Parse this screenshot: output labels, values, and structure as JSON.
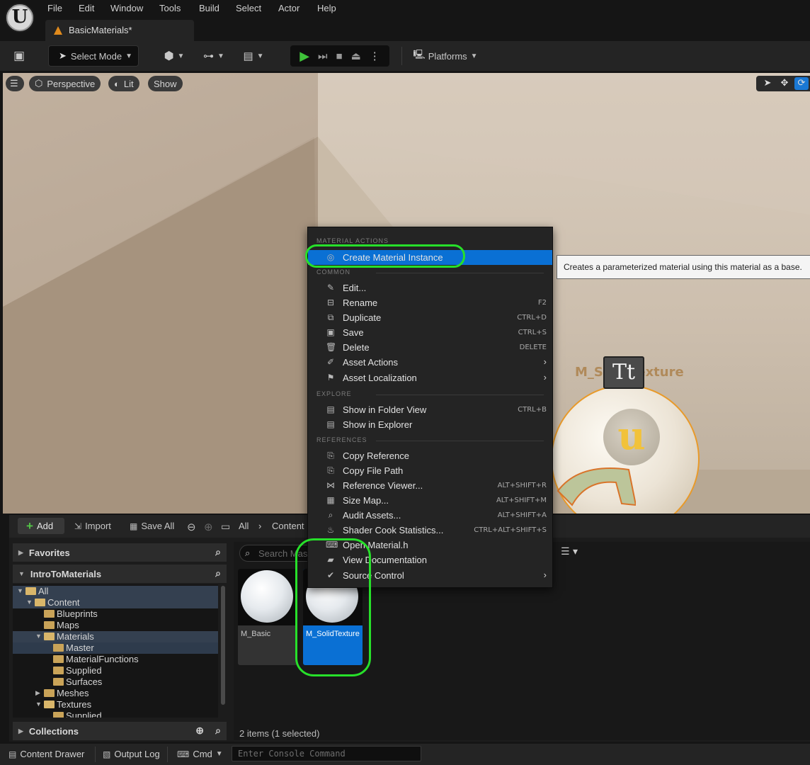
{
  "menubar": {
    "items": [
      "File",
      "Edit",
      "Window",
      "Tools",
      "Build",
      "Select",
      "Actor",
      "Help"
    ],
    "tab_label": "BasicMaterials*"
  },
  "toolbar": {
    "select_mode": "Select Mode",
    "platforms": "Platforms"
  },
  "viewport": {
    "menu_btn": "☰",
    "perspective": "Perspective",
    "lit": "Lit",
    "show": "Show",
    "sphere_label": "M_SolidTexture",
    "badge_text": "Tt"
  },
  "context_menu": {
    "sections": {
      "material_actions": "MATERIAL ACTIONS",
      "common": "COMMON",
      "explore": "EXPLORE",
      "references": "REFERENCES"
    },
    "items": [
      {
        "label": "Create Material Instance",
        "shortcut": "",
        "icon": "material-instance-icon",
        "glyph": "◎"
      },
      {
        "label": "Edit...",
        "shortcut": "",
        "icon": "pencil-icon",
        "glyph": "✎"
      },
      {
        "label": "Rename",
        "shortcut": "F2",
        "icon": "rename-icon",
        "glyph": "⊟"
      },
      {
        "label": "Duplicate",
        "shortcut": "CTRL+D",
        "icon": "duplicate-icon",
        "glyph": "⧉"
      },
      {
        "label": "Save",
        "shortcut": "CTRL+S",
        "icon": "save-icon",
        "glyph": "▣"
      },
      {
        "label": "Delete",
        "shortcut": "DELETE",
        "icon": "trash-icon",
        "glyph": "🗑"
      },
      {
        "label": "Asset Actions",
        "shortcut": "",
        "icon": "wrench-icon",
        "glyph": "✐",
        "submenu": true
      },
      {
        "label": "Asset Localization",
        "shortcut": "",
        "icon": "flag-icon",
        "glyph": "⚑",
        "submenu": true
      },
      {
        "label": "Show in Folder View",
        "shortcut": "CTRL+B",
        "icon": "folder-search-icon",
        "glyph": "▤"
      },
      {
        "label": "Show in Explorer",
        "shortcut": "",
        "icon": "explorer-icon",
        "glyph": "▤"
      },
      {
        "label": "Copy Reference",
        "shortcut": "",
        "icon": "copy-reference-icon",
        "glyph": "⎘"
      },
      {
        "label": "Copy File Path",
        "shortcut": "",
        "icon": "copy-path-icon",
        "glyph": "⎘"
      },
      {
        "label": "Reference Viewer...",
        "shortcut": "ALT+SHIFT+R",
        "icon": "reference-viewer-icon",
        "glyph": "⋈"
      },
      {
        "label": "Size Map...",
        "shortcut": "ALT+SHIFT+M",
        "icon": "size-map-icon",
        "glyph": "▦"
      },
      {
        "label": "Audit Assets...",
        "shortcut": "ALT+SHIFT+A",
        "icon": "audit-icon",
        "glyph": "⌕"
      },
      {
        "label": "Shader Cook Statistics...",
        "shortcut": "CTRL+ALT+SHIFT+S",
        "icon": "stats-icon",
        "glyph": "♨"
      },
      {
        "label": "Open Material.h",
        "shortcut": "",
        "icon": "code-file-icon",
        "glyph": "⌨"
      },
      {
        "label": "View Documentation",
        "shortcut": "",
        "icon": "book-icon",
        "glyph": "▰"
      },
      {
        "label": "Source Control",
        "shortcut": "",
        "icon": "source-control-icon",
        "glyph": "✔",
        "submenu": true
      }
    ]
  },
  "tooltip": "Creates a parameterized material using this material as a base.",
  "content_browser": {
    "add": "Add",
    "import": "Import",
    "save_all": "Save All",
    "breadcrumb": [
      "All",
      "Content"
    ],
    "favorites": "Favorites",
    "project": "IntroToMaterials",
    "collections": "Collections",
    "tree": [
      {
        "label": "All",
        "depth": 0,
        "expanded": true,
        "state": "hl"
      },
      {
        "label": "Content",
        "depth": 1,
        "expanded": true,
        "state": "hl"
      },
      {
        "label": "Blueprints",
        "depth": 2,
        "expanded": null,
        "state": ""
      },
      {
        "label": "Maps",
        "depth": 2,
        "expanded": null,
        "state": ""
      },
      {
        "label": "Materials",
        "depth": 2,
        "expanded": true,
        "state": "hl"
      },
      {
        "label": "Master",
        "depth": 3,
        "expanded": null,
        "state": "sel"
      },
      {
        "label": "MaterialFunctions",
        "depth": 3,
        "expanded": null,
        "state": ""
      },
      {
        "label": "Supplied",
        "depth": 3,
        "expanded": null,
        "state": ""
      },
      {
        "label": "Surfaces",
        "depth": 3,
        "expanded": null,
        "state": ""
      },
      {
        "label": "Meshes",
        "depth": 2,
        "expanded": false,
        "state": ""
      },
      {
        "label": "Textures",
        "depth": 2,
        "expanded": true,
        "state": ""
      },
      {
        "label": "Supplied",
        "depth": 3,
        "expanded": null,
        "state": ""
      }
    ],
    "search_placeholder": "Search Master",
    "assets": [
      {
        "name": "M_Basic",
        "selected": false
      },
      {
        "name": "M_SolidTexture",
        "selected": true
      }
    ],
    "item_count": "2 items (1 selected)"
  },
  "statusbar": {
    "content_drawer": "Content Drawer",
    "output_log": "Output Log",
    "cmd": "Cmd",
    "console_placeholder": "Enter Console Command"
  }
}
